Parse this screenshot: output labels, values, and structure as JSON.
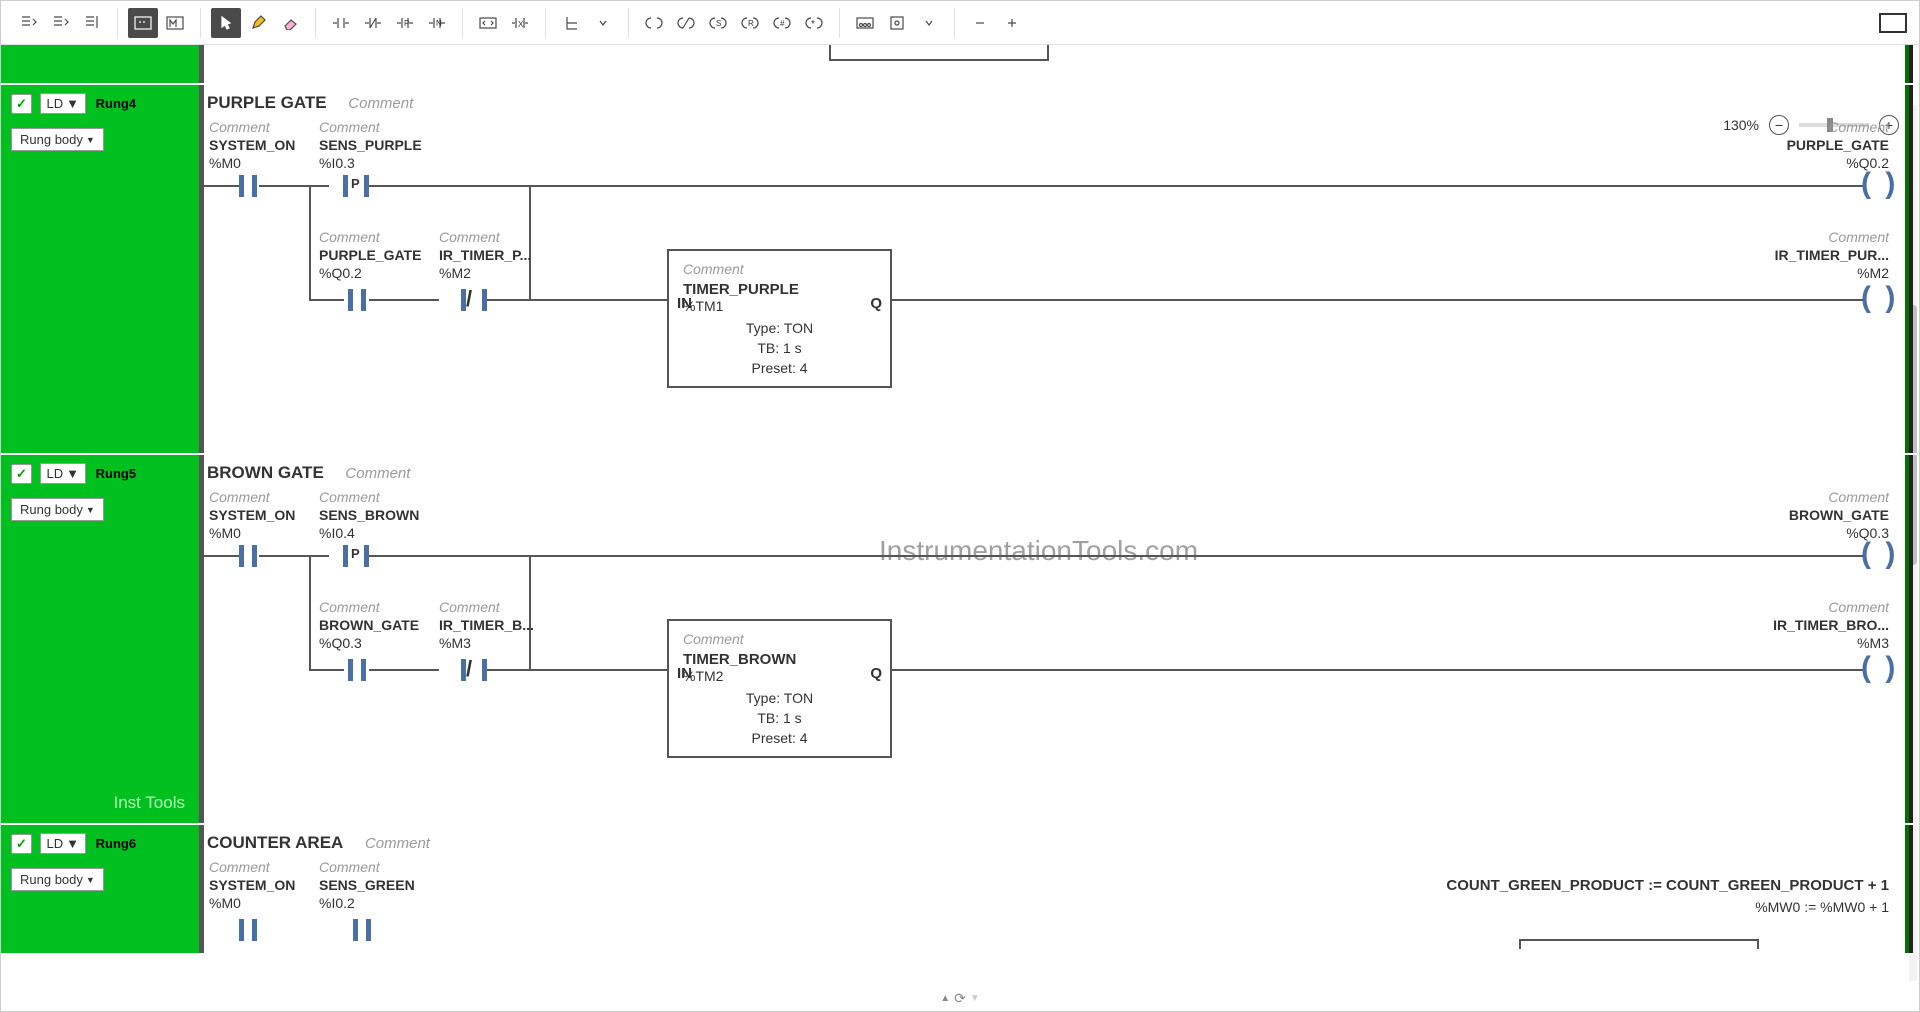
{
  "zoom": "130%",
  "toolbar_icons": [
    "insert-before",
    "insert-after",
    "insert-branch",
    "comment-block",
    "label-block",
    "pointer",
    "pencil",
    "eraser",
    "contact-no",
    "contact-nc",
    "contact-p",
    "contact-n",
    "coil-bracket",
    "compare",
    "parallel",
    "block-insert",
    "coil-open",
    "coil-nc",
    "set-coil",
    "reset-coil",
    "hash-coil",
    "star-coil",
    "operate-block",
    "func-block",
    "drop-down",
    "minus",
    "plus"
  ],
  "rung4": {
    "name": "Rung4",
    "title": "PURPLE GATE",
    "ld": "LD",
    "body_sel": "Rung body",
    "comment_ph": "Comment",
    "c1": {
      "name": "SYSTEM_ON",
      "addr": "%M0"
    },
    "c2": {
      "name": "SENS_PURPLE",
      "addr": "%I0.3"
    },
    "out1": {
      "name": "PURPLE_GATE",
      "addr": "%Q0.2"
    },
    "c3": {
      "name": "PURPLE_GATE",
      "addr": "%Q0.2"
    },
    "c4": {
      "name": "IR_TIMER_P...",
      "addr": "%M2"
    },
    "out2": {
      "name": "IR_TIMER_PUR...",
      "addr": "%M2"
    },
    "timer": {
      "name": "TIMER_PURPLE",
      "addr": "%TM1",
      "type": "Type:  TON",
      "tb": "TB:  1 s",
      "preset": "Preset:  4",
      "in": "IN",
      "out": "Q"
    }
  },
  "rung5": {
    "name": "Rung5",
    "title": "BROWN GATE",
    "ld": "LD",
    "body_sel": "Rung body",
    "comment_ph": "Comment",
    "c1": {
      "name": "SYSTEM_ON",
      "addr": "%M0"
    },
    "c2": {
      "name": "SENS_BROWN",
      "addr": "%I0.4"
    },
    "out1": {
      "name": "BROWN_GATE",
      "addr": "%Q0.3"
    },
    "c3": {
      "name": "BROWN_GATE",
      "addr": "%Q0.3"
    },
    "c4": {
      "name": "IR_TIMER_B...",
      "addr": "%M3"
    },
    "out2": {
      "name": "IR_TIMER_BRO...",
      "addr": "%M3"
    },
    "timer": {
      "name": "TIMER_BROWN",
      "addr": "%TM2",
      "type": "Type:  TON",
      "tb": "TB:  1 s",
      "preset": "Preset:  4",
      "in": "IN",
      "out": "Q"
    },
    "watermark": "InstrumentationTools.com",
    "side_footer": "Inst Tools"
  },
  "rung6": {
    "name": "Rung6",
    "title": "COUNTER AREA",
    "ld": "LD",
    "body_sel": "Rung body",
    "comment_ph": "Comment",
    "c1": {
      "name": "SYSTEM_ON",
      "addr": "%M0"
    },
    "c2": {
      "name": "SENS_GREEN",
      "addr": "%I0.2"
    },
    "op_line": "COUNT_GREEN_PRODUCT := COUNT_GREEN_PRODUCT + 1",
    "op_addr": "%MW0 := %MW0 + 1"
  }
}
